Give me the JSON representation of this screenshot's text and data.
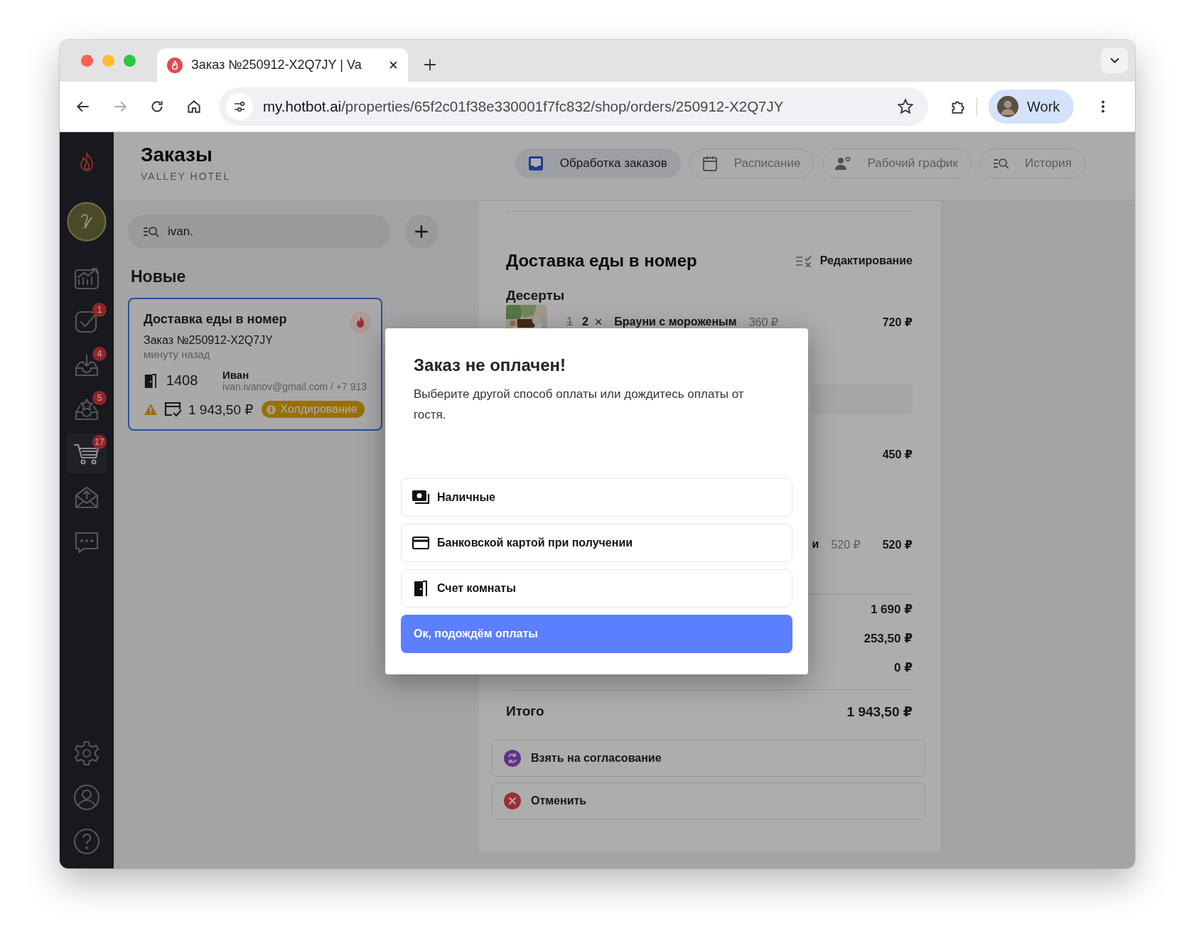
{
  "browser": {
    "tab_title": "Заказ №250912-X2Q7JY | Va",
    "url_host": "my.hotbot.ai",
    "url_path": "/properties/65f2c01f38e330001f7fc832/shop/orders/250912-X2Q7JY",
    "profile": "Work"
  },
  "sidebar": {
    "items": [
      {
        "selected": false
      },
      {
        "badge": "1",
        "selected": false
      },
      {
        "badge": "4",
        "selected": false
      },
      {
        "badge": "5",
        "selected": false
      },
      {
        "badge": "17",
        "selected": true
      },
      {
        "selected": false
      },
      {
        "selected": false
      }
    ]
  },
  "header": {
    "title": "Заказы",
    "subtitle": "VALLEY HOTEL",
    "tabs": [
      {
        "label": "Обработка заказов",
        "selected": true
      },
      {
        "label": "Расписание",
        "selected": false
      },
      {
        "label": "Рабочий график",
        "selected": false
      },
      {
        "label": "История",
        "selected": false
      }
    ]
  },
  "orders": {
    "search": {
      "value": "ivan."
    },
    "section": "Новые",
    "cards": [
      {
        "title": "Доставка еды в номер",
        "number": "Заказ №250912-X2Q7JY",
        "time": "минуту назад",
        "room": "1408",
        "guest": "Иван",
        "contact": "ivan.ivanov@gmail.com / +7 913",
        "amount": "1 943,50 ₽",
        "status": "Холдирование",
        "selected": true
      }
    ]
  },
  "detail": {
    "title": "Доставка еды в номер",
    "edit": "Редактирование",
    "category": "Десерты",
    "items": [
      {
        "old_qty": "1",
        "qty": "2",
        "times": "×",
        "name": "Брауни с мороженым",
        "price": "360 ₽",
        "total": "720 ₽"
      },
      {
        "total": "450 ₽"
      },
      {
        "name": "и",
        "price": "520 ₽",
        "total": "520 ₽"
      }
    ],
    "totals": [
      "1 690 ₽",
      "253,50 ₽",
      "0 ₽"
    ],
    "grand_label": "Итого",
    "grand_total": "1 943,50 ₽",
    "actions": [
      {
        "label": "Взять на согласование",
        "kind": "approve"
      },
      {
        "label": "Отменить",
        "kind": "cancel"
      }
    ]
  },
  "modal": {
    "title": "Заказ не оплачен!",
    "text": "Выберите другой способ оплаты или дождитесь оплаты от гостя.",
    "options": [
      {
        "label": "Наличные"
      },
      {
        "label": "Банковской картой при получении"
      },
      {
        "label": "Счет комнаты"
      }
    ],
    "button": "Ок, подождём оплаты"
  }
}
